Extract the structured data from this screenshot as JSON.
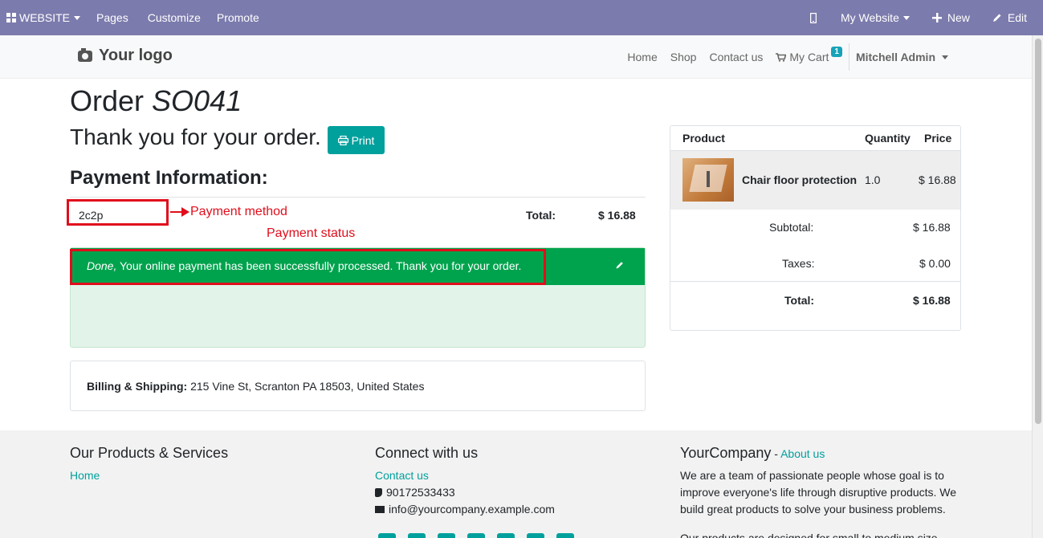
{
  "admin_bar": {
    "website_label": "WEBSITE",
    "pages": "Pages",
    "customize": "Customize",
    "promote": "Promote",
    "my_website": "My Website",
    "new": "New",
    "edit": "Edit"
  },
  "header": {
    "logo": "Your logo",
    "nav": [
      "Home",
      "Shop",
      "Contact us",
      "My Cart"
    ],
    "cart_count": "1",
    "user": "Mitchell Admin"
  },
  "order": {
    "title_prefix": "Order",
    "number": "SO041",
    "thanks": "Thank you for your order.",
    "print": "Print",
    "payment_heading": "Payment Information:",
    "payment_method": "2c2p",
    "total_label": "Total:",
    "total_value": "$ 16.88",
    "status_word": "Done,",
    "status_message": " Your online payment has been successfully processed. Thank you for your order.",
    "billing_label": "Billing & Shipping:",
    "billing_address": " 215 Vine St, Scranton PA 18503, United States"
  },
  "annotations": {
    "payment_method": "Payment method",
    "payment_status": "Payment status"
  },
  "summary": {
    "col_product": "Product",
    "col_quantity": "Quantity",
    "col_price": "Price",
    "product_name": "Chair floor protection",
    "product_qty": "1.0",
    "product_price": "$ 16.88",
    "subtotal_label": "Subtotal:",
    "subtotal_value": "$ 16.88",
    "taxes_label": "Taxes:",
    "taxes_value": "$ 0.00",
    "total_label": "Total:",
    "total_value": "$ 16.88"
  },
  "footer": {
    "col1_title": "Our Products & Services",
    "col1_link": "Home",
    "col2_title": "Connect with us",
    "col2_link": "Contact us",
    "phone": "90172533433",
    "email": "info@yourcompany.example.com",
    "col3_title": "YourCompany",
    "col3_sep": " - ",
    "col3_link": "About us",
    "col3_text1": "We are a team of passionate people whose goal is to",
    "col3_text2": "improve everyone's life through disruptive products. We",
    "col3_text3": "build great products to solve your business problems.",
    "col3_text4": "Our products are designed for small to medium size"
  }
}
